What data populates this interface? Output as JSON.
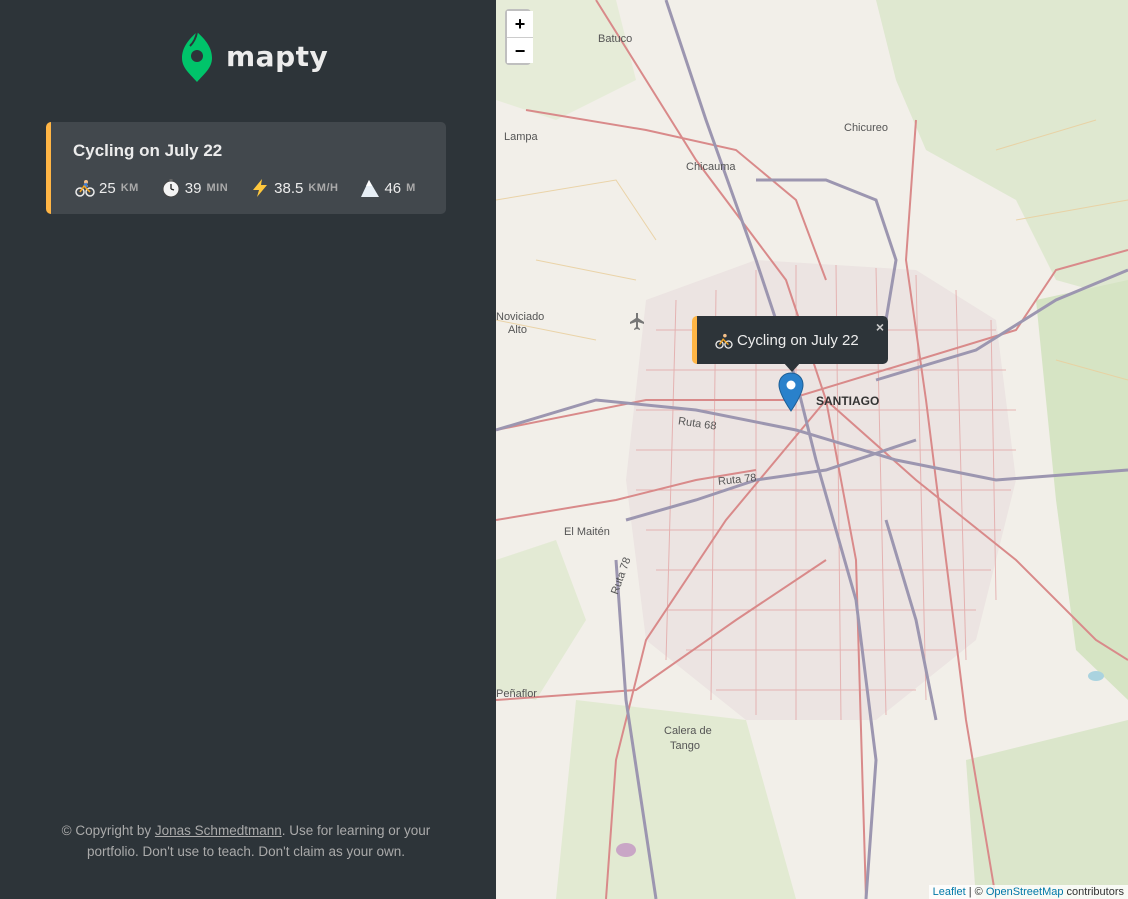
{
  "app": {
    "logo_text": "mapty",
    "brand_color": "#00c46a",
    "accent_color": "#ffb545"
  },
  "workouts": [
    {
      "title": "Cycling on July 22",
      "type": "cycling",
      "distance": {
        "icon": "bicyclist-icon",
        "value": "25",
        "unit": "km"
      },
      "duration": {
        "icon": "stopwatch-icon",
        "value": "39",
        "unit": "min"
      },
      "speed": {
        "icon": "lightning-icon",
        "value": "38.5",
        "unit": "km/h"
      },
      "elevation": {
        "icon": "mountain-icon",
        "value": "46",
        "unit": "m"
      }
    }
  ],
  "footer": {
    "prefix": "© Copyright by ",
    "author": "Jonas Schmedtmann",
    "suffix": ". Use for learning or your portfolio. Don't use to teach. Don't claim as your own."
  },
  "map": {
    "zoom_in": "+",
    "zoom_out": "−",
    "popup_text": "Cycling on July 22",
    "popup_close": "×",
    "labels": {
      "batuco": "Batuco",
      "lampa": "Lampa",
      "chicureo": "Chicureo",
      "chicauma": "Chicauma",
      "noviciado": "Noviciado",
      "alto": "Alto",
      "santiago": "SANTIAGO",
      "ruta68": "Ruta 68",
      "ruta78a": "Ruta 78",
      "ruta78b": "Ruta 78",
      "elmaiten": "El Maitén",
      "penaflor": "Peñaflor",
      "calera": "Calera de",
      "tango": "Tango"
    },
    "attribution": {
      "leaflet": "Leaflet",
      "sep": " | © ",
      "osm": "OpenStreetMap",
      "suffix": " contributors"
    }
  }
}
